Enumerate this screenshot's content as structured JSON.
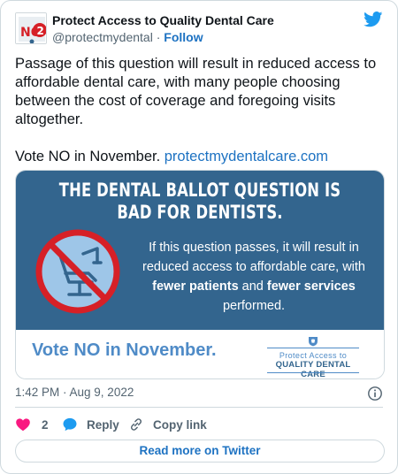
{
  "account": {
    "display_name": "Protect Access to Quality Dental Care",
    "handle": "@protectmydental",
    "separator": "·",
    "follow_label": "Follow",
    "avatar_text": "NO"
  },
  "tweet": {
    "text_paragraph_1": "Passage of this question will result in reduced access to affordable dental care, with many people choosing between the cost of coverage and foregoing visits altogether.",
    "text_paragraph_2_prefix": "Vote NO in November. ",
    "text_link": "protectmydentalcare.com",
    "timestamp": "1:42 PM · Aug 9, 2022"
  },
  "media": {
    "title_line_1": "THE DENTAL BALLOT QUESTION IS",
    "title_line_2": "BAD FOR DENTISTS.",
    "body_part_1": "If this question passes, it will result in reduced access to affordable care, with ",
    "body_bold_1": "fewer patients",
    "body_part_2": " and ",
    "body_bold_2": "fewer services",
    "body_part_3": " performed.",
    "vote_text": "Vote NO in November.",
    "logo_line_1": "Protect Access to",
    "logo_line_2": "QUALITY DENTAL CARE"
  },
  "actions": {
    "like_count": "2",
    "reply_label": "Reply",
    "copy_link_label": "Copy link"
  },
  "footer": {
    "read_more_label": "Read more on Twitter"
  },
  "colors": {
    "link_blue": "#1d72c2",
    "twitter_blue": "#1d9bf0",
    "media_blue": "#33658e",
    "heart_pink": "#f91880",
    "no_red": "#d62027"
  },
  "icons": {
    "logo": "twitter-bird-icon",
    "info": "info-icon",
    "like": "heart-icon",
    "reply": "speech-bubble-icon",
    "copy_link": "chain-link-icon"
  }
}
